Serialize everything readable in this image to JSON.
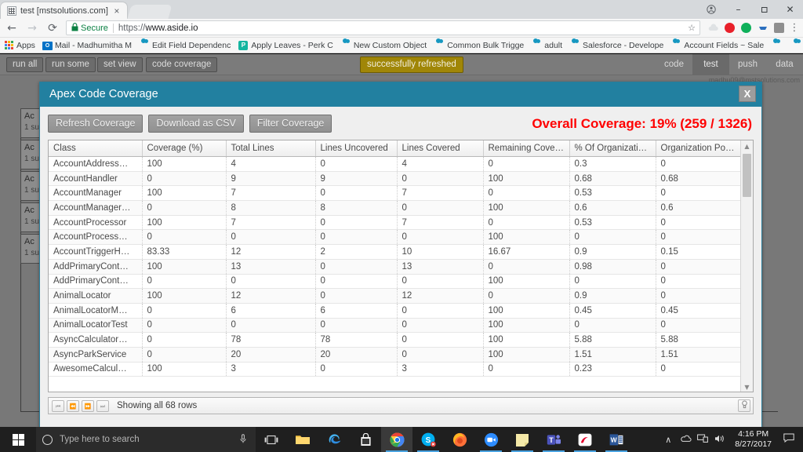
{
  "browser": {
    "tab": {
      "title": "test [mstsolutions.com]",
      "close_label": "×",
      "favicon": "page-favicon"
    },
    "window_controls": {
      "profile": "●",
      "minimize": "–",
      "maximize": "❐",
      "close": "✕"
    },
    "nav": {
      "back": "←",
      "forward": "→",
      "reload": "⟳"
    },
    "omnibox": {
      "lock": "🔒",
      "secure_label": "Secure",
      "url_scheme": "https://",
      "url_host": "www.aside.io",
      "star": "☆"
    },
    "extensions": [
      "cloud-extension-icon",
      "opera-extension-icon",
      "green-extension-icon",
      "blue-extension-icon",
      "grey-extension-icon"
    ],
    "ext_menu": "⋮",
    "bookmarks": {
      "apps_label": "Apps",
      "items": [
        {
          "label": "Mail - Madhumitha M",
          "icon": "outlook-icon"
        },
        {
          "label": "Edit Field Dependenc",
          "icon": "salesforce-cloud-icon"
        },
        {
          "label": "Apply Leaves - Perk C",
          "icon": "perk-icon"
        },
        {
          "label": "New Custom Object",
          "icon": "salesforce-cloud-icon"
        },
        {
          "label": "Common Bulk Trigge",
          "icon": "salesforce-cloud-icon"
        },
        {
          "label": "adult",
          "icon": "salesforce-cloud-icon"
        },
        {
          "label": "Salesforce - Develope",
          "icon": "salesforce-cloud-icon"
        },
        {
          "label": "Account Fields ~ Sale",
          "icon": "salesforce-cloud-icon"
        },
        {
          "label": "",
          "icon": "salesforce-cloud-icon"
        },
        {
          "label": "",
          "icon": "salesforce-cloud-icon"
        }
      ],
      "overflow": "»"
    }
  },
  "aside": {
    "toolbar_buttons": [
      "run all",
      "run some",
      "set view",
      "code coverage"
    ],
    "toast": "successfully refreshed",
    "right_tabs": [
      {
        "label": "code",
        "active": false
      },
      {
        "label": "test",
        "active": true
      },
      {
        "label": "push",
        "active": false
      },
      {
        "label": "data",
        "active": false
      }
    ],
    "user_email": "madhu09@mstsolutions.com",
    "background_cards": [
      {
        "line1": "Ac",
        "line2": "1 su"
      },
      {
        "line1": "Ac",
        "line2": "1 su"
      },
      {
        "line1": "Ac",
        "line2": "1 su"
      },
      {
        "line1": "Ac",
        "line2": "1 su"
      },
      {
        "line1": "Ac",
        "line2": "1 su"
      }
    ]
  },
  "modal": {
    "title": "Apex Code Coverage",
    "close_label": "X",
    "buttons": {
      "refresh": "Refresh Coverage",
      "download": "Download as CSV",
      "filter": "Filter Coverage"
    },
    "overall_coverage": "Overall Coverage: 19% (259 / 1326)",
    "overall_color": "#ff0000",
    "header_color": "#2280a0",
    "footer": {
      "first": "⏮",
      "prev": "⏪",
      "next": "⏩",
      "last": "⏭",
      "status": "Showing all 68 rows",
      "settings_icon": "column-settings-icon"
    },
    "scrollbar": {
      "up": "▲",
      "down": "▼"
    }
  },
  "table": {
    "columns": [
      "Class",
      "Coverage (%)",
      "Total Lines",
      "Lines Uncovered",
      "Lines Covered",
      "Remaining Cove…",
      "% Of Organizatio…",
      "Organization Pot…"
    ],
    "rows": [
      [
        "AccountAddress…",
        "100",
        "4",
        "0",
        "4",
        "0",
        "0.3",
        "0"
      ],
      [
        "AccountHandler",
        "0",
        "9",
        "9",
        "0",
        "100",
        "0.68",
        "0.68"
      ],
      [
        "AccountManager",
        "100",
        "7",
        "0",
        "7",
        "0",
        "0.53",
        "0"
      ],
      [
        "AccountManager…",
        "0",
        "8",
        "8",
        "0",
        "100",
        "0.6",
        "0.6"
      ],
      [
        "AccountProcessor",
        "100",
        "7",
        "0",
        "7",
        "0",
        "0.53",
        "0"
      ],
      [
        "AccountProcess…",
        "0",
        "0",
        "0",
        "0",
        "100",
        "0",
        "0"
      ],
      [
        "AccountTriggerH…",
        "83.33",
        "12",
        "2",
        "10",
        "16.67",
        "0.9",
        "0.15"
      ],
      [
        "AddPrimaryCont…",
        "100",
        "13",
        "0",
        "13",
        "0",
        "0.98",
        "0"
      ],
      [
        "AddPrimaryCont…",
        "0",
        "0",
        "0",
        "0",
        "100",
        "0",
        "0"
      ],
      [
        "AnimalLocator",
        "100",
        "12",
        "0",
        "12",
        "0",
        "0.9",
        "0"
      ],
      [
        "AnimalLocatorM…",
        "0",
        "6",
        "6",
        "0",
        "100",
        "0.45",
        "0.45"
      ],
      [
        "AnimalLocatorTest",
        "0",
        "0",
        "0",
        "0",
        "100",
        "0",
        "0"
      ],
      [
        "AsyncCalculator…",
        "0",
        "78",
        "78",
        "0",
        "100",
        "5.88",
        "5.88"
      ],
      [
        "AsyncParkService",
        "0",
        "20",
        "20",
        "0",
        "100",
        "1.51",
        "1.51"
      ],
      [
        "AwesomeCalcul…",
        "100",
        "3",
        "0",
        "3",
        "0",
        "0.23",
        "0"
      ]
    ]
  },
  "taskbar": {
    "start": "start-button",
    "search_placeholder": "Type here to search",
    "mic": "🎤",
    "items": [
      "task-view-icon",
      "file-explorer-icon",
      "edge-icon",
      "store-icon",
      "chrome-icon",
      "skype-icon",
      "firefox-icon",
      "zoom-icon",
      "sticky-notes-icon",
      "teams-icon",
      "airtel-icon",
      "word-icon"
    ],
    "tray": [
      "∧",
      "🔊",
      "🖥",
      "🔉"
    ],
    "time": "4:16 PM",
    "date": "8/27/2017",
    "action_center": "🗪"
  }
}
